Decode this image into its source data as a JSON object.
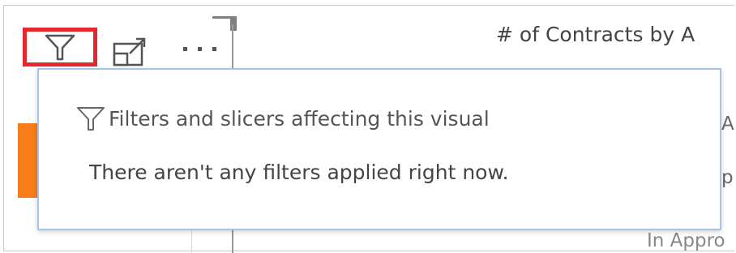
{
  "header": {
    "title": "# of Contracts by A"
  },
  "toolbar": {
    "filter_icon": "filter-icon",
    "focus_icon": "focus-mode-icon",
    "more_icon": "more-options-icon",
    "highlight_color": "#e8262e"
  },
  "tooltip": {
    "heading": "Filters and slicers affecting this visual",
    "body": "There aren't any filters applied right now.",
    "border_color": "#a6c3ea"
  },
  "background": {
    "peek_text_1": "A",
    "peek_text_2": "p",
    "peek_text_3": "In Appro",
    "accent_color": "#f77c1a"
  }
}
